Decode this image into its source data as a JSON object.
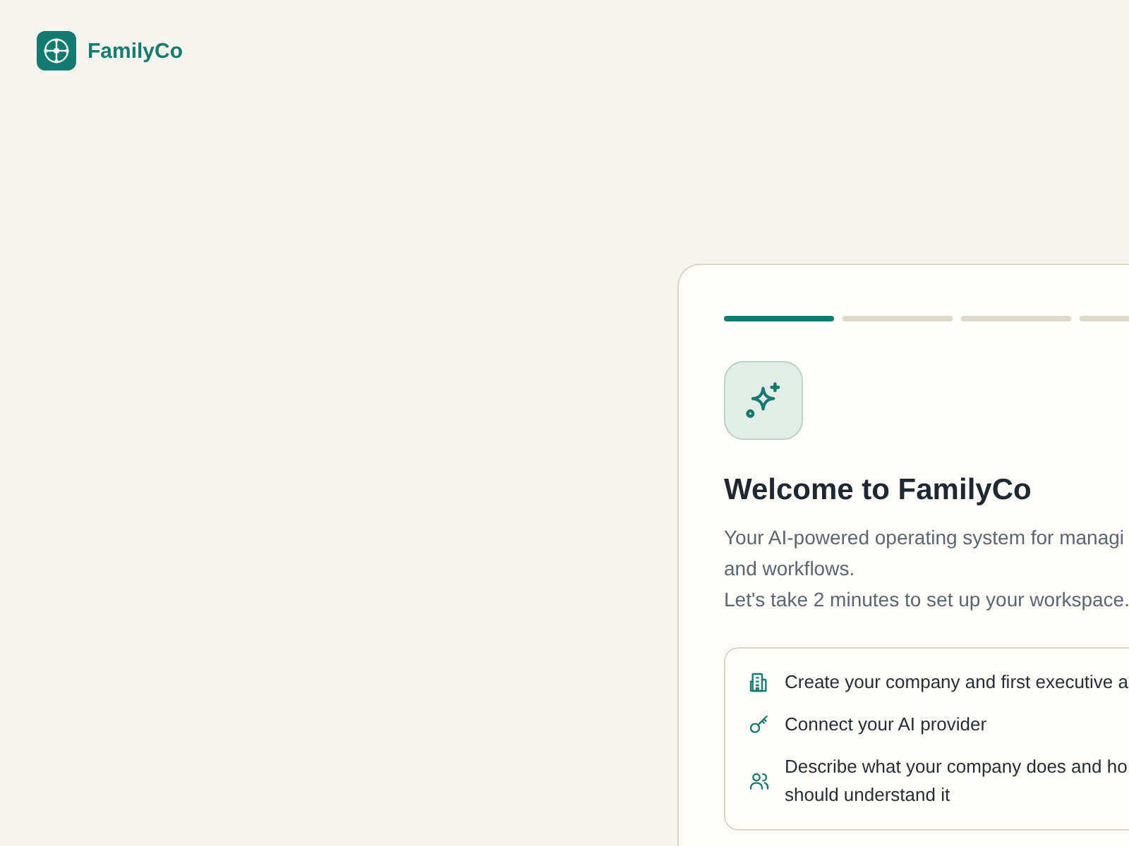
{
  "brand": {
    "name": "FamilyCo"
  },
  "steps": [
    {
      "active": true
    },
    {
      "active": false
    },
    {
      "active": false
    },
    {
      "active": false
    }
  ],
  "welcome": {
    "title": "Welcome to FamilyCo",
    "description_lines": [
      "Your AI-powered operating system for managi",
      "and workflows.",
      "Let's take 2 minutes to set up your workspace."
    ]
  },
  "checklist": [
    {
      "kind": "building",
      "lines": [
        "Create your company and first executive a"
      ]
    },
    {
      "kind": "key",
      "lines": [
        "Connect your AI provider"
      ]
    },
    {
      "kind": "people",
      "lines": [
        "Describe what your company does and ho",
        "should understand it"
      ]
    }
  ]
}
